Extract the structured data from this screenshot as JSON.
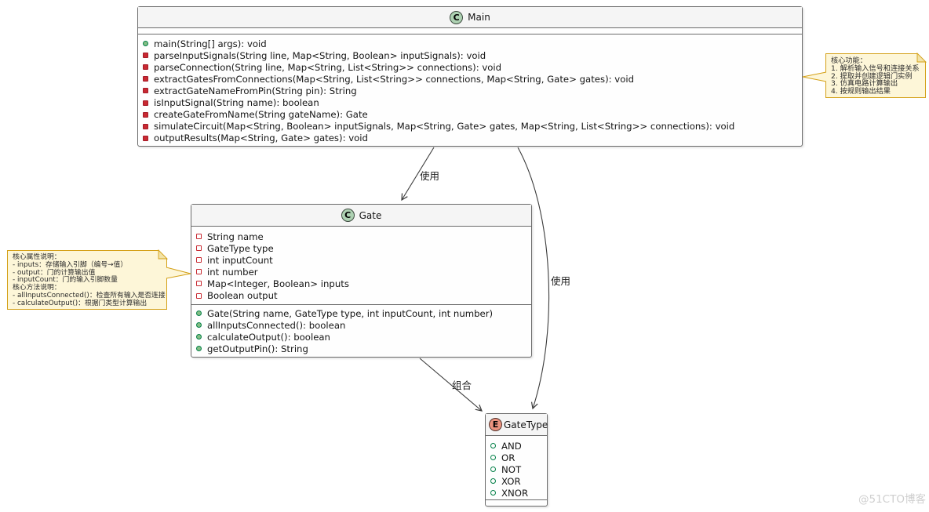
{
  "classes": {
    "main": {
      "stereotype": "C",
      "name": "Main",
      "methods": [
        {
          "vis": "public-method",
          "text": "main(String[] args): void"
        },
        {
          "vis": "private-method",
          "text": "parseInputSignals(String line, Map<String, Boolean> inputSignals): void"
        },
        {
          "vis": "private-method",
          "text": "parseConnection(String line, Map<String, List<String>> connections): void"
        },
        {
          "vis": "private-method",
          "text": "extractGatesFromConnections(Map<String, List<String>> connections, Map<String, Gate> gates): void"
        },
        {
          "vis": "private-method",
          "text": "extractGateNameFromPin(String pin): String"
        },
        {
          "vis": "private-method",
          "text": "isInputSignal(String name): boolean"
        },
        {
          "vis": "private-method",
          "text": "createGateFromName(String gateName): Gate"
        },
        {
          "vis": "private-method",
          "text": "simulateCircuit(Map<String, Boolean> inputSignals, Map<String, Gate> gates, Map<String, List<String>> connections): void"
        },
        {
          "vis": "private-method",
          "text": "outputResults(Map<String, Gate> gates): void"
        }
      ]
    },
    "gate": {
      "stereotype": "C",
      "name": "Gate",
      "fields": [
        {
          "vis": "private-field",
          "text": "String name"
        },
        {
          "vis": "private-field",
          "text": "GateType type"
        },
        {
          "vis": "private-field",
          "text": "int inputCount"
        },
        {
          "vis": "private-field",
          "text": "int number"
        },
        {
          "vis": "private-field",
          "text": "Map<Integer, Boolean> inputs"
        },
        {
          "vis": "private-field",
          "text": "Boolean output"
        }
      ],
      "methods": [
        {
          "vis": "public-method",
          "text": "Gate(String name, GateType type, int inputCount, int number)"
        },
        {
          "vis": "public-method",
          "text": "allInputsConnected(): boolean"
        },
        {
          "vis": "public-method",
          "text": "calculateOutput(): boolean"
        },
        {
          "vis": "public-method",
          "text": "getOutputPin(): String"
        }
      ]
    },
    "gatetype": {
      "stereotype": "E",
      "name": "GateType",
      "values": [
        {
          "vis": "public-field",
          "text": "AND"
        },
        {
          "vis": "public-field",
          "text": "OR"
        },
        {
          "vis": "public-field",
          "text": "NOT"
        },
        {
          "vis": "public-field",
          "text": "XOR"
        },
        {
          "vis": "public-field",
          "text": "XNOR"
        }
      ]
    }
  },
  "notes": {
    "main_note": {
      "lines": [
        "核心功能：",
        "1. 解析输入信号和连接关系",
        "2. 提取并创建逻辑门实例",
        "3. 仿真电路计算输出",
        "4. 按规则输出结果"
      ]
    },
    "gate_note": {
      "lines": [
        "核心属性说明：",
        "- inputs：存储输入引脚（编号→值）",
        "- output：门的计算输出值",
        "- inputCount：门的输入引脚数量",
        "核心方法说明：",
        "- allInputsConnected()：检查所有输入是否连接",
        "- calculateOutput()：根据门类型计算输出"
      ]
    }
  },
  "edges": {
    "main_gate": {
      "label": "使用"
    },
    "main_gatetype": {
      "label": "使用"
    },
    "gate_gatetype": {
      "label": "组合"
    }
  },
  "watermark": "@51CTO博客",
  "colors": {
    "class_icon_bg": "#ADD1B2",
    "enum_icon_bg": "#EB937F",
    "note_bg": "#FDF6D8",
    "note_border": "#D4A017",
    "public_icon": "#038048",
    "public_icon_fill": "#84BE84",
    "private_icon": "#C82931",
    "box_border": "#6B6B6B",
    "arrow": "#3B3B3B",
    "watermark_text": "#CFCFCF"
  }
}
